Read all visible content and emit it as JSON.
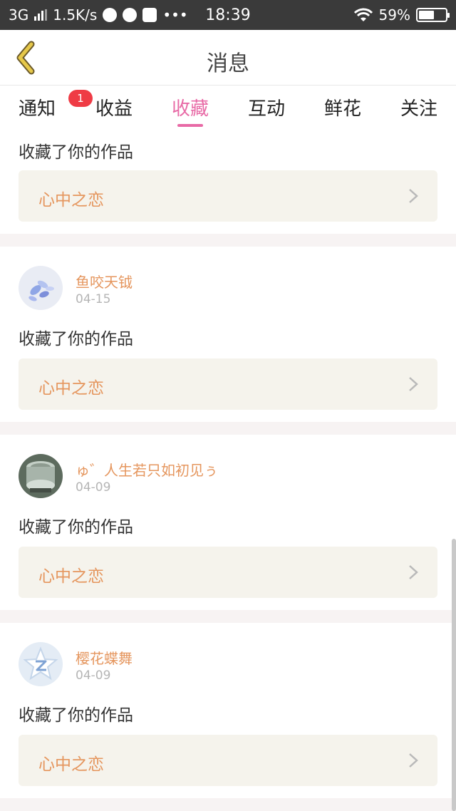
{
  "status_bar": {
    "network": "3G",
    "speed": "1.5K/s",
    "time": "18:39",
    "battery": "59%",
    "battery_level": 0.59
  },
  "header": {
    "title": "消息"
  },
  "tabs": [
    {
      "label": "通知",
      "badge": "1"
    },
    {
      "label": "收益"
    },
    {
      "label": "收藏",
      "active": true
    },
    {
      "label": "互动"
    },
    {
      "label": "鲜花"
    },
    {
      "label": "关注"
    }
  ],
  "feed": [
    {
      "action": "收藏了你的作品",
      "work_title": "心中之恋"
    },
    {
      "username": "鱼咬天钺",
      "date": "04-15",
      "action": "收藏了你的作品",
      "work_title": "心中之恋"
    },
    {
      "username": "ゅ゛人生若只如初见ぅ",
      "date": "04-09",
      "action": "收藏了你的作品",
      "work_title": "心中之恋"
    },
    {
      "username": "樱花蝶舞",
      "date": "04-09",
      "action": "收藏了你的作品",
      "work_title": "心中之恋"
    }
  ],
  "colors": {
    "accent": "#e86aa6",
    "username": "#e5965e",
    "badge": "#ef3b45",
    "back_icon": "#d9b83a"
  },
  "icons": [
    "back-arrow-icon",
    "chevron-right-icon",
    "wifi-icon",
    "signal-icon",
    "battery-icon"
  ]
}
